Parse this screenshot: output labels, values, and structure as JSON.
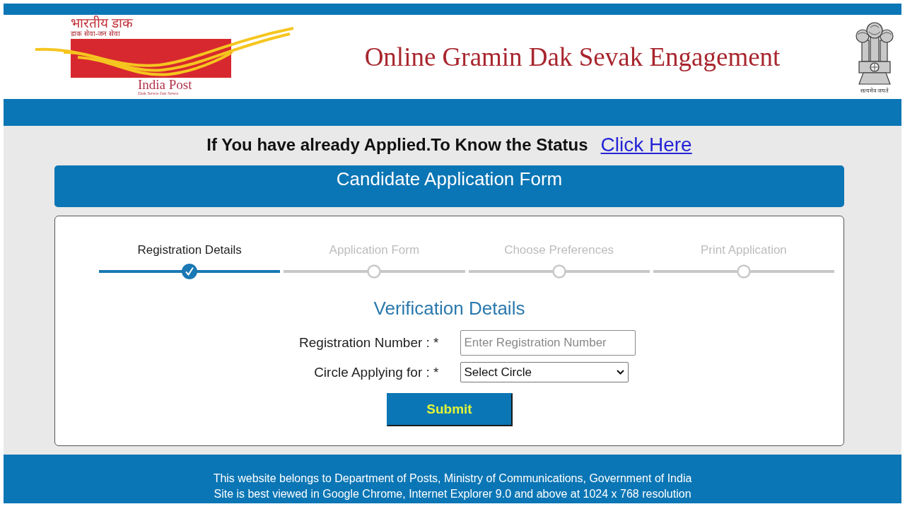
{
  "header": {
    "logo": {
      "hindi_name": "भारतीय डाक",
      "hindi_motto": "डाक सेवा-जन सेवा",
      "name": "India Post",
      "motto": "Dak Sewa-Jan Sewa"
    },
    "title": "Online Gramin Dak Sevak Engagement",
    "emblem": {
      "motto": "सत्यमेव जयते"
    }
  },
  "status_notice": {
    "text": "If You have already Applied.To Know the Status",
    "link": "Click Here"
  },
  "banner": {
    "title": "Candidate Application Form"
  },
  "form": {
    "steps": [
      {
        "label": "Registration Details",
        "completed": true
      },
      {
        "label": "Application Form",
        "completed": false
      },
      {
        "label": "Choose Preferences",
        "completed": false
      },
      {
        "label": "Print Application",
        "completed": false
      }
    ],
    "heading": "Verification Details",
    "fields": [
      {
        "kind": "text",
        "label": "Registration Number : *",
        "placeholder": "Enter Registration Number"
      },
      {
        "kind": "select",
        "label": "Circle Applying for : *",
        "value": "Select Circle"
      }
    ],
    "submit": "Submit"
  },
  "footer": {
    "lines": [
      "This website belongs to Department of Posts, Ministry of Communications, Government of India",
      "Site is best viewed in Google Chrome, Internet Explorer 9.0 and above at 1024 x 768 resolution"
    ]
  }
}
